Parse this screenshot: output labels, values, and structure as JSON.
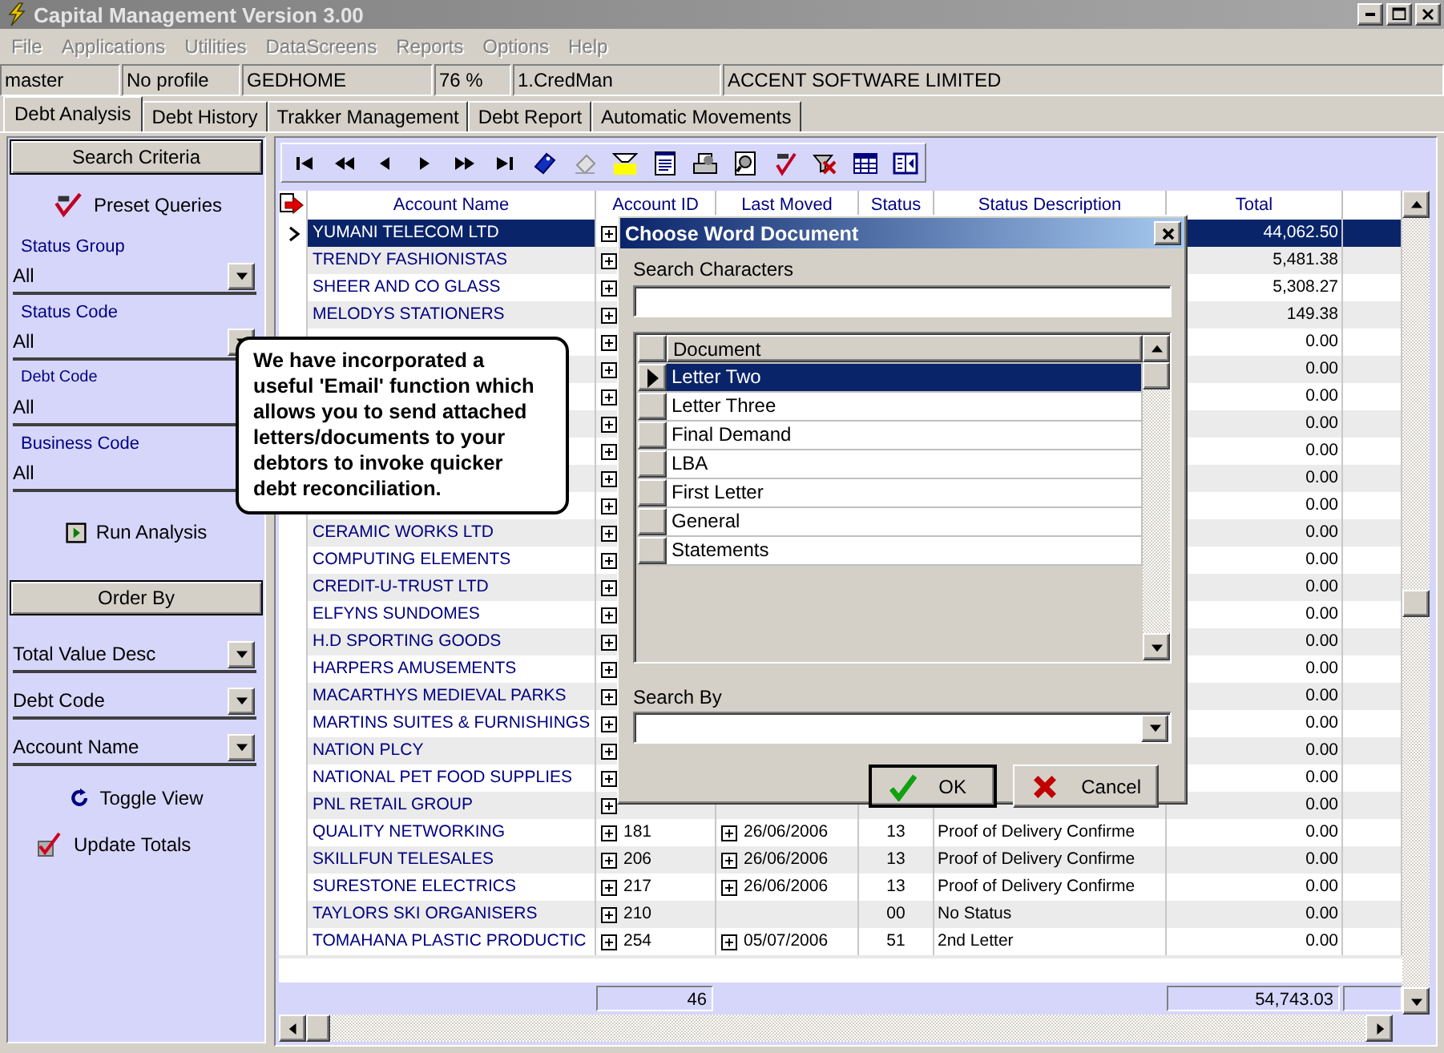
{
  "window": {
    "title": "Capital Management Version 3.00"
  },
  "menu": [
    {
      "label": "File",
      "disabled": true
    },
    {
      "label": "Applications",
      "disabled": true
    },
    {
      "label": "Utilities",
      "disabled": true
    },
    {
      "label": "DataScreens",
      "disabled": true
    },
    {
      "label": "Reports",
      "disabled": true
    },
    {
      "label": "Options",
      "disabled": true
    },
    {
      "label": "Help",
      "disabled": true
    }
  ],
  "info_bar": [
    "master",
    "No profile",
    "GEDHOME",
    "76 %",
    "1.CredMan",
    "ACCENT SOFTWARE LIMITED"
  ],
  "tabs": [
    {
      "label": "Debt Analysis",
      "selected": true
    },
    {
      "label": "Debt History",
      "selected": false
    },
    {
      "label": "Trakker Management",
      "selected": false
    },
    {
      "label": "Debt Report",
      "selected": false
    },
    {
      "label": "Automatic Movements",
      "selected": false
    }
  ],
  "sidebar": {
    "search_button": "Search Criteria",
    "preset_queries": "Preset Queries",
    "filters": [
      {
        "label": "Status Group",
        "value": "All"
      },
      {
        "label": "Status Code",
        "value": "All"
      },
      {
        "label": "Debt Code",
        "value": "All"
      },
      {
        "label": "Business Code",
        "value": "All"
      }
    ],
    "run_button": "Run Analysis",
    "order_button": "Order By",
    "order_fields": [
      "Total Value Desc",
      "Debt Code",
      "Account Name"
    ],
    "toggle_view": "Toggle View",
    "update_totals": {
      "label": "Update Totals",
      "checked": true
    }
  },
  "table": {
    "columns": [
      "Account Name",
      "Account ID",
      "Last Moved",
      "Status",
      "Status Description",
      "Total"
    ],
    "rows": [
      {
        "name": "YUMANI TELECOM LTD",
        "total": "44,062.50",
        "selected": true
      },
      {
        "name": "TRENDY FASHIONISTAS",
        "total": "5,481.38",
        "selected": false
      },
      {
        "name": "SHEER AND CO GLASS",
        "total": "5,308.27",
        "selected": false
      },
      {
        "name": "MELODYS STATIONERS",
        "total": "149.38",
        "selected": false
      },
      {
        "total": "0.00",
        "selected": false
      },
      {
        "total": "0.00",
        "selected": false
      },
      {
        "total": "0.00",
        "selected": false
      },
      {
        "total": "0.00",
        "selected": false
      },
      {
        "total": "0.00",
        "selected": false
      },
      {
        "total": "0.00",
        "selected": false
      },
      {
        "total": "0.00",
        "selected": false
      },
      {
        "name": "CERAMIC WORKS LTD",
        "total": "0.00",
        "selected": false
      },
      {
        "name": "COMPUTING ELEMENTS",
        "total": "0.00",
        "selected": false
      },
      {
        "name": "CREDIT-U-TRUST LTD",
        "total": "0.00",
        "selected": false
      },
      {
        "name": "ELFYNS SUNDOMES",
        "total": "0.00",
        "selected": false
      },
      {
        "name": "H.D SPORTING GOODS",
        "total": "0.00",
        "selected": false
      },
      {
        "name": "HARPERS AMUSEMENTS",
        "total": "0.00",
        "selected": false
      },
      {
        "name": "MACARTHYS MEDIEVAL PARKS",
        "total": "0.00",
        "selected": false
      },
      {
        "name": "MARTINS SUITES & FURNISHINGS",
        "total": "0.00",
        "selected": false
      },
      {
        "name": "NATION PLCY",
        "total": "0.00",
        "selected": false
      },
      {
        "name": "NATIONAL PET FOOD SUPPLIES",
        "total": "0.00",
        "selected": false
      },
      {
        "name": "PNL RETAIL GROUP",
        "total": "0.00",
        "selected": false
      },
      {
        "name": "QUALITY  NETWORKING",
        "account_id": "181",
        "last_moved": "26/06/2006",
        "status": "13",
        "status_description": "Proof of Delivery Confirme",
        "total": "0.00",
        "selected": false
      },
      {
        "name": "SKILLFUN TELESALES",
        "account_id": "206",
        "last_moved": "26/06/2006",
        "status": "13",
        "status_description": "Proof of Delivery Confirme",
        "total": "0.00",
        "selected": false
      },
      {
        "name": "SURESTONE ELECTRICS",
        "account_id": "217",
        "last_moved": "26/06/2006",
        "status": "13",
        "status_description": "Proof of Delivery Confirme",
        "total": "0.00",
        "selected": false
      },
      {
        "name": "TAYLORS SKI ORGANISERS",
        "account_id": "210",
        "status": "00",
        "status_description": "No Status",
        "total": "0.00",
        "selected": false
      },
      {
        "name": "TOMAHANA PLASTIC PRODUCTIC",
        "account_id": "254",
        "last_moved": "05/07/2006",
        "status": "51",
        "status_description": "2nd Letter",
        "total": "0.00",
        "selected": false
      }
    ],
    "totals": {
      "account_id": "46",
      "total": "54,743.03"
    }
  },
  "dialog": {
    "title": "Choose Word Document",
    "search_label": "Search Characters",
    "list_header": "Document",
    "documents": [
      {
        "name": "Letter Two",
        "selected": true
      },
      {
        "name": "Letter Three",
        "selected": false
      },
      {
        "name": "Final Demand",
        "selected": false
      },
      {
        "name": "LBA",
        "selected": false
      },
      {
        "name": "First Letter",
        "selected": false
      },
      {
        "name": "General",
        "selected": false
      },
      {
        "name": "Statements",
        "selected": false
      }
    ],
    "search_by_label": "Search By",
    "buttons": [
      {
        "label": "OK",
        "kind": "ok",
        "default": true
      },
      {
        "label": "Cancel",
        "kind": "cancel",
        "default": false
      }
    ]
  },
  "callout": {
    "text": "We have incorporated a useful 'Email' function which allows you to send attached letters/documents to your debtors to invoke quicker debt reconciliation."
  }
}
